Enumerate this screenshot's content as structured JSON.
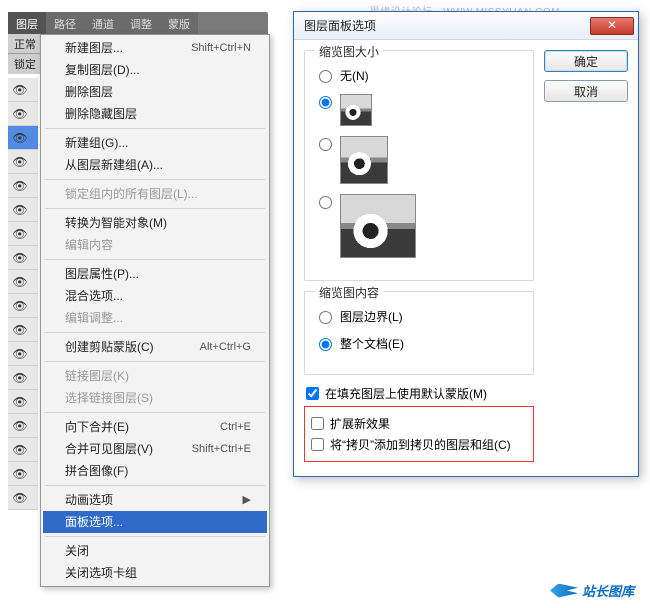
{
  "watermark_top": "思缘设计论坛 · WWW.MISSYUAN.COM",
  "watermark_bottom": "站长图库",
  "panel": {
    "tabs": [
      "图层",
      "路径",
      "通道",
      "调整",
      "蒙版"
    ],
    "toolbar_label_1": "正常",
    "toolbar_label_2": "锁定"
  },
  "menu": {
    "new_layer": "新建图层...",
    "new_layer_sc": "Shift+Ctrl+N",
    "dup_layer": "复制图层(D)...",
    "del_layer": "删除图层",
    "del_hidden": "删除隐藏图层",
    "new_group": "新建组(G)...",
    "group_from": "从图层新建组(A)...",
    "lock_group": "锁定组内的所有图层(L)...",
    "smart_obj": "转换为智能对象(M)",
    "edit_content": "编辑内容",
    "layer_props": "图层属性(P)...",
    "blend_opts": "混合选项...",
    "edit_adjust": "编辑调整...",
    "clip_mask": "创建剪贴蒙版(C)",
    "clip_mask_sc": "Alt+Ctrl+G",
    "link_layers": "链接图层(K)",
    "select_linked": "选择链接图层(S)",
    "merge_down": "向下合并(E)",
    "merge_down_sc": "Ctrl+E",
    "merge_visible": "合并可见图层(V)",
    "merge_visible_sc": "Shift+Ctrl+E",
    "flatten": "拼合图像(F)",
    "anim_opts": "动画选项",
    "panel_opts": "面板选项...",
    "close": "关闭",
    "close_tabs": "关闭选项卡组"
  },
  "dialog": {
    "title": "图层面板选项",
    "ok": "确定",
    "cancel": "取消",
    "group_thumbsize": "缩览图大小",
    "opt_none": "无(N)",
    "group_thumbcontent": "缩览图内容",
    "opt_bounds": "图层边界(L)",
    "opt_document": "整个文档(E)",
    "chk_usemask": "在填充图层上使用默认蒙版(M)",
    "chk_expand": "扩展新效果",
    "chk_addcopy": "将“拷贝”添加到拷贝的图层和组(C)"
  }
}
